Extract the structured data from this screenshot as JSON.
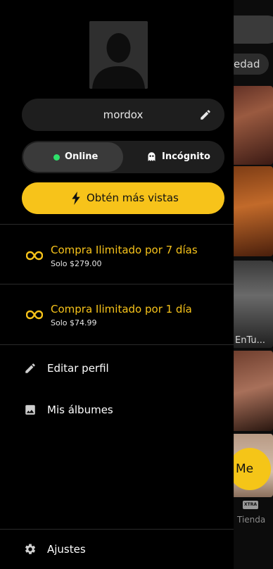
{
  "background": {
    "chip_partial_label": "edad",
    "tile_caption_partial": "EnTu...",
    "fab_partial_label": "Me",
    "xtra_badge": "XTRA",
    "tienda_label": "Tienda"
  },
  "profile": {
    "username": "mordox"
  },
  "status": {
    "online_label": "Online",
    "incognito_label": "Incógnito",
    "selected": "Online"
  },
  "boost": {
    "label": "Obtén más vistas"
  },
  "offers": [
    {
      "title": "Compra Ilimitado por 7 días",
      "price": "Solo $279.00"
    },
    {
      "title": "Compra Ilimitado por 1 día",
      "price": "Solo $74.99"
    }
  ],
  "menu": {
    "edit_profile": "Editar perfil",
    "albums": "Mis álbumes",
    "settings": "Ajustes"
  },
  "colors": {
    "accent": "#f7c31a",
    "online_dot": "#2ee06a",
    "drawer_bg": "#000000",
    "field_bg": "#1e1e1e"
  },
  "icons": {
    "edit": "pencil-icon",
    "incognito": "ghost-icon",
    "boost": "lightning-icon",
    "offer": "infinity-icon",
    "albums": "image-icon",
    "settings": "gear-icon"
  }
}
